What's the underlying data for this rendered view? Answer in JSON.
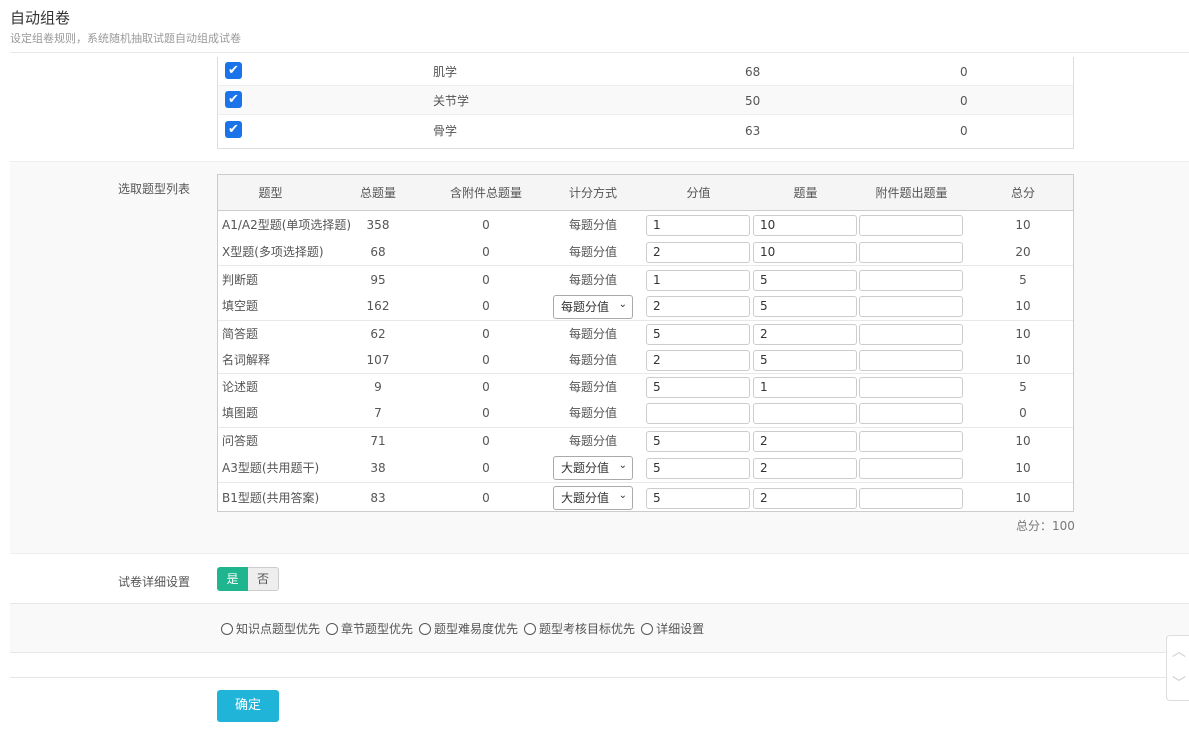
{
  "header": {
    "title": "自动组卷",
    "subtitle": "设定组卷规则，系统随机抽取试题自动组成试卷"
  },
  "chapters": [
    {
      "name": "肌学",
      "count": "68",
      "attach": "0",
      "checked": true
    },
    {
      "name": "关节学",
      "count": "50",
      "attach": "0",
      "checked": true
    },
    {
      "name": "骨学",
      "count": "63",
      "attach": "0",
      "checked": true
    }
  ],
  "question_types": {
    "label": "选取题型列表",
    "headers": [
      "题型",
      "总题量",
      "含附件总题量",
      "计分方式",
      "分值",
      "题量",
      "附件题出题量",
      "总分"
    ],
    "rows": [
      {
        "type": "A1/A2型题(单项选择题)",
        "total": "358",
        "attach": "0",
        "method": "每题分值",
        "dropdown": false,
        "score": "1",
        "qty": "10",
        "attach_qty": "",
        "sum": "10"
      },
      {
        "type": "X型题(多项选择题)",
        "total": "68",
        "attach": "0",
        "method": "每题分值",
        "dropdown": false,
        "score": "2",
        "qty": "10",
        "attach_qty": "",
        "sum": "20"
      },
      {
        "type": "判断题",
        "total": "95",
        "attach": "0",
        "method": "每题分值",
        "dropdown": false,
        "score": "1",
        "qty": "5",
        "attach_qty": "",
        "sum": "5"
      },
      {
        "type": "填空题",
        "total": "162",
        "attach": "0",
        "method": "每题分值",
        "dropdown": true,
        "score": "2",
        "qty": "5",
        "attach_qty": "",
        "sum": "10"
      },
      {
        "type": "简答题",
        "total": "62",
        "attach": "0",
        "method": "每题分值",
        "dropdown": false,
        "score": "5",
        "qty": "2",
        "attach_qty": "",
        "sum": "10"
      },
      {
        "type": "名词解释",
        "total": "107",
        "attach": "0",
        "method": "每题分值",
        "dropdown": false,
        "score": "2",
        "qty": "5",
        "attach_qty": "",
        "sum": "10"
      },
      {
        "type": "论述题",
        "total": "9",
        "attach": "0",
        "method": "每题分值",
        "dropdown": false,
        "score": "5",
        "qty": "1",
        "attach_qty": "",
        "sum": "5"
      },
      {
        "type": "填图题",
        "total": "7",
        "attach": "0",
        "method": "每题分值",
        "dropdown": false,
        "score": "",
        "qty": "",
        "attach_qty": "",
        "sum": "0"
      },
      {
        "type": "问答题",
        "total": "71",
        "attach": "0",
        "method": "每题分值",
        "dropdown": false,
        "score": "5",
        "qty": "2",
        "attach_qty": "",
        "sum": "10"
      },
      {
        "type": "A3型题(共用题干)",
        "total": "38",
        "attach": "0",
        "method": "大题分值",
        "dropdown": true,
        "score": "5",
        "qty": "2",
        "attach_qty": "",
        "sum": "10"
      },
      {
        "type": "B1型题(共用答案)",
        "total": "83",
        "attach": "0",
        "method": "大题分值",
        "dropdown": true,
        "score": "5",
        "qty": "2",
        "attach_qty": "",
        "sum": "10"
      }
    ],
    "total_note": "总分：100"
  },
  "detail_settings": {
    "label": "试卷详细设置",
    "yes": "是",
    "no": "否",
    "selected": "是"
  },
  "priority_options": [
    "知识点题型优先",
    "章节题型优先",
    "题型难易度优先",
    "题型考核目标优先",
    "详细设置"
  ],
  "confirm_label": "确定",
  "icons": {
    "check": "check-icon",
    "dropdown": "chevron-down-icon",
    "scroll_up": "chevron-up-icon",
    "scroll_down": "chevron-down-icon"
  },
  "colors": {
    "checkbox": "#1a73e8",
    "toggle_on": "#1fb58f",
    "confirm": "#1fb4d8"
  }
}
